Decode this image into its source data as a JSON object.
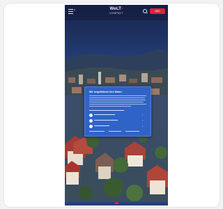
{
  "header": {
    "menu_icon": "hamburger-menu-icon",
    "back_icon": "back-arrow-icon",
    "back_glyph": "‹",
    "logo_text": "WeLT",
    "logo_accent": "•",
    "logo_subtitle": "KOMPAKT",
    "search_icon": "search-icon",
    "action_label": "ABO"
  },
  "dialog": {
    "title": "Wir respektieren Ihre Daten",
    "options": [
      {
        "icon": "toggle-icon",
        "chevron": "›"
      },
      {
        "icon": "toggle-icon",
        "chevron": "›"
      },
      {
        "icon": "toggle-icon",
        "chevron": "›"
      }
    ]
  },
  "colors": {
    "dialog_background": "#2f63c8",
    "brand_red": "#d9263a",
    "header_background": "#141c3c"
  }
}
